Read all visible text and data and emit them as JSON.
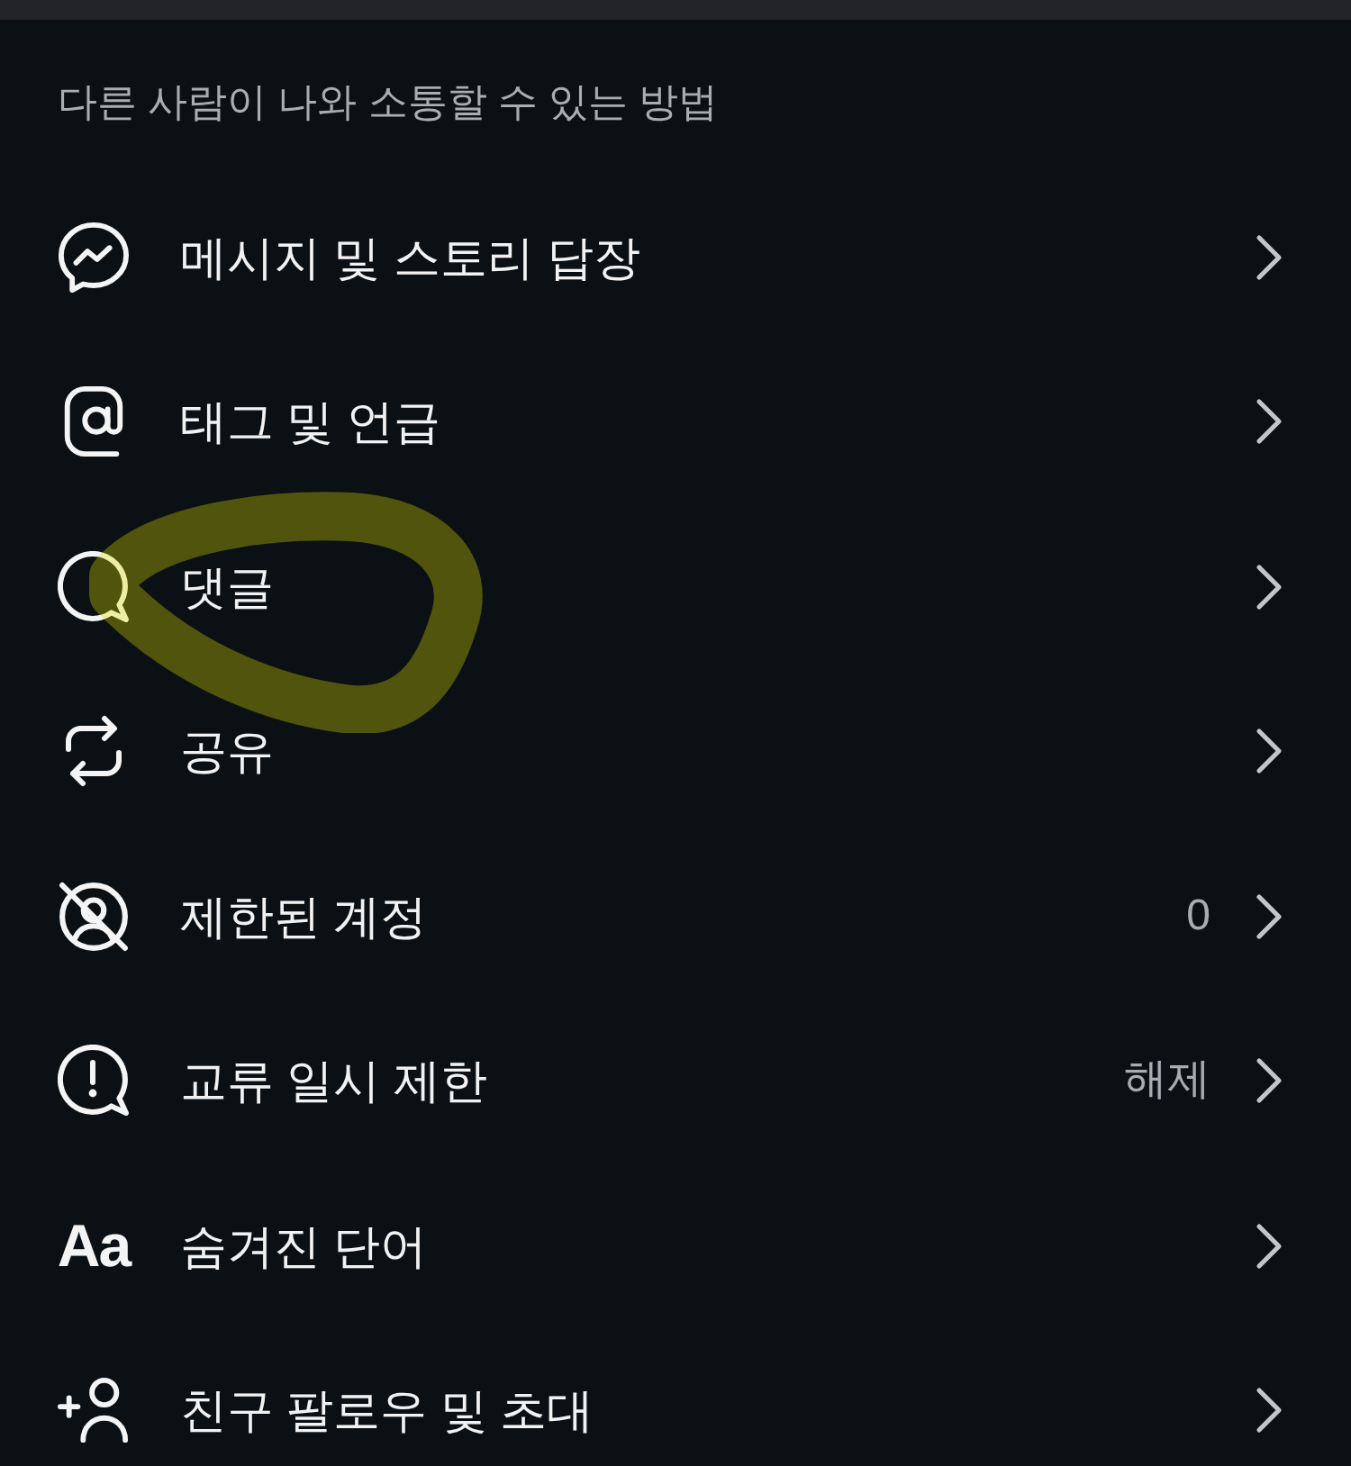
{
  "section_title": "다른 사람이 나와 소통할 수 있는 방법",
  "items": [
    {
      "label": "메시지 및 스토리 답장",
      "circled": false
    },
    {
      "label": "태그 및 언급",
      "circled": false
    },
    {
      "label": "댓글",
      "circled": true
    },
    {
      "label": "공유",
      "circled": false
    },
    {
      "label": "제한된 계정",
      "value": "0",
      "circled": false
    },
    {
      "label": "교류 일시 제한",
      "value": "해제",
      "circled": false
    },
    {
      "label": "숨겨진 단어",
      "icon_text": "Aa",
      "circled": false
    },
    {
      "label": "친구 팔로우 및 초대",
      "circled": false
    }
  ]
}
